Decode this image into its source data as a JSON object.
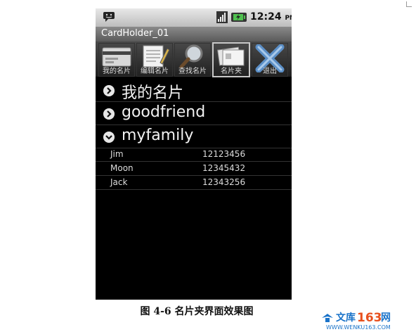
{
  "status_bar": {
    "time": "12:24",
    "ampm": "PM"
  },
  "app_title": "CardHolder_01",
  "toolbar": {
    "items": [
      {
        "label": "我的名片",
        "icon": "card-icon"
      },
      {
        "label": "编辑名片",
        "icon": "edit-document-icon"
      },
      {
        "label": "查找名片",
        "icon": "magnifier-icon"
      },
      {
        "label": "名片夹",
        "icon": "card-folder-icon",
        "selected": true
      },
      {
        "label": "退出",
        "icon": "close-x-icon"
      }
    ]
  },
  "list": {
    "groups": [
      {
        "label": "我的名片",
        "expanded": false
      },
      {
        "label": "goodfriend",
        "expanded": false
      },
      {
        "label": "myfamily",
        "expanded": true
      }
    ],
    "children": [
      {
        "name": "Jim",
        "number": "12123456"
      },
      {
        "name": "Moon",
        "number": "12345432"
      },
      {
        "name": "Jack",
        "number": "12343256"
      }
    ]
  },
  "caption": "图 4-6 名片夹界面效果图",
  "watermark": {
    "brand_text": "文库163网",
    "url": "WWW.WENKU163.COM"
  }
}
